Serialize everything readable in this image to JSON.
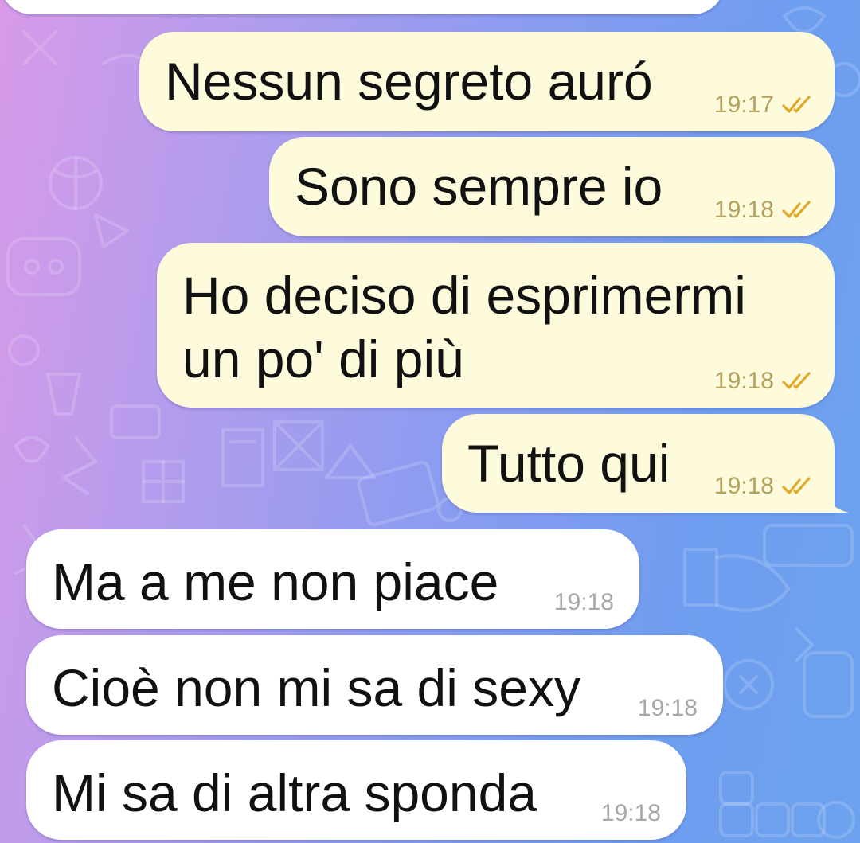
{
  "theme": {
    "outgoing_bubble_color": "#fefbdc",
    "incoming_bubble_color": "#ffffff",
    "read_tick_color": "#e0a92a",
    "outgoing_time_color": "#b3a15e",
    "incoming_time_color": "#a8a8a8"
  },
  "messages": [
    {
      "direction": "outgoing",
      "lines": [
        "Nessun segreto auró"
      ],
      "time": "19:17",
      "status_icon": "double-check-icon"
    },
    {
      "direction": "outgoing",
      "lines": [
        "Sono sempre io"
      ],
      "time": "19:18",
      "status_icon": "double-check-icon"
    },
    {
      "direction": "outgoing",
      "lines": [
        "Ho deciso di esprimermi",
        "un po' di più"
      ],
      "time": "19:18",
      "status_icon": "double-check-icon"
    },
    {
      "direction": "outgoing",
      "lines": [
        "Tutto qui"
      ],
      "time": "19:18",
      "status_icon": "double-check-icon"
    },
    {
      "direction": "incoming",
      "lines": [
        "Ma a me non piace"
      ],
      "time": "19:18"
    },
    {
      "direction": "incoming",
      "lines": [
        "Cioè non mi sa di sexy"
      ],
      "time": "19:18"
    },
    {
      "direction": "incoming",
      "lines": [
        "Mi sa di altra sponda"
      ],
      "time": "19:18"
    }
  ]
}
